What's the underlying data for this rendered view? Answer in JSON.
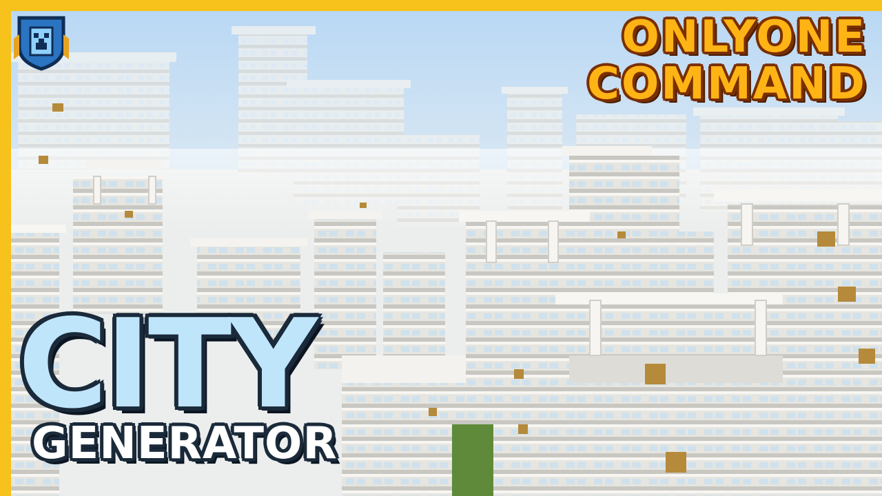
{
  "thumbnail": {
    "title_line1": "ONLYONE",
    "title_line2": "COMMAND",
    "main_word": "CITY",
    "sub_word": "GENERATOR"
  },
  "colors": {
    "frame": "#f6c21b",
    "title_fill": "#ffb416",
    "title_outline": "#7a2f00",
    "city_fill": "#bfe5fb",
    "outline_dark": "#1a2a3a",
    "quartz": "#ecebe6",
    "quartz_shadow": "#c9c8c2",
    "glowstone": "#b58a3a",
    "glass": "#cfe4f0",
    "grass": "#5e8a3a"
  },
  "icons": {
    "channel_logo": "creeper-crest-icon"
  }
}
